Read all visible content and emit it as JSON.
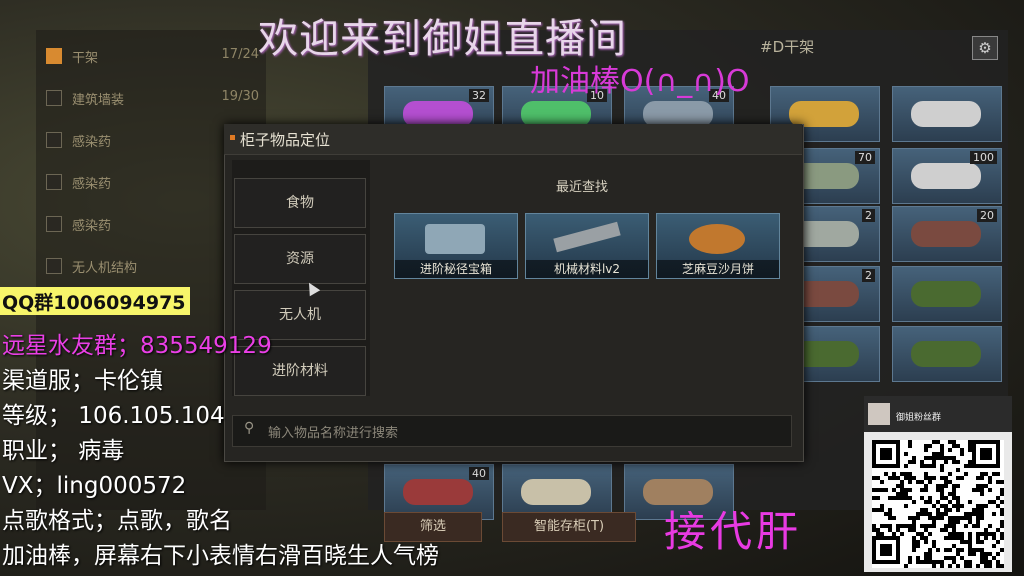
{
  "left_list": [
    {
      "label": "干架",
      "count": "17/24",
      "active": true
    },
    {
      "label": "建筑墙装",
      "count": "19/30",
      "active": false
    },
    {
      "label": "感染药",
      "count": "",
      "active": false
    },
    {
      "label": "感染药",
      "count": "",
      "active": false
    },
    {
      "label": "感染药",
      "count": "",
      "active": false
    },
    {
      "label": "无人机结构",
      "count": "",
      "active": false
    }
  ],
  "right_panel": {
    "title": "#D干架",
    "gear_icon": "⚙",
    "slot_counts": [
      "32",
      "10",
      "40",
      "70",
      "100",
      "2",
      "20",
      "2",
      "40"
    ]
  },
  "modal": {
    "title": "柜子物品定位",
    "categories": [
      "食物",
      "资源",
      "无人机",
      "进阶材料"
    ],
    "recent_label": "最近查找",
    "recent_items": [
      {
        "name": "进阶秘径宝箱"
      },
      {
        "name": "机械材料lv2"
      },
      {
        "name": "芝麻豆沙月饼"
      }
    ],
    "search_placeholder": "输入物品名称进行搜索"
  },
  "bottom": {
    "filter": "筛选",
    "smart_store": "智能存柜(T)"
  },
  "overlay": {
    "title": "欢迎来到御姐直播间",
    "subtitle": "加油棒O(∩_∩)O",
    "qq": "QQ群1006094975",
    "lines": [
      {
        "text": "远星水友群；835549129",
        "magenta": true
      },
      {
        "text": "渠道服；卡伦镇",
        "magenta": false
      },
      {
        "text": "等级；      106.105.104",
        "magenta": false
      },
      {
        "text": "职业；      病毒",
        "magenta": false
      },
      {
        "text": "VX；ling000572",
        "magenta": false
      },
      {
        "text": "点歌格式；点歌，歌名",
        "magenta": false
      },
      {
        "text": "加油棒，屏幕右下小表情右滑百晓生人气榜",
        "magenta": false
      }
    ],
    "big": "接代肝",
    "qr_name": "御姐粉丝群"
  },
  "colors": {
    "accent": "#e07a24",
    "overlay_magenta": "#ea3fe6",
    "qq_bg": "#f7f56a"
  }
}
